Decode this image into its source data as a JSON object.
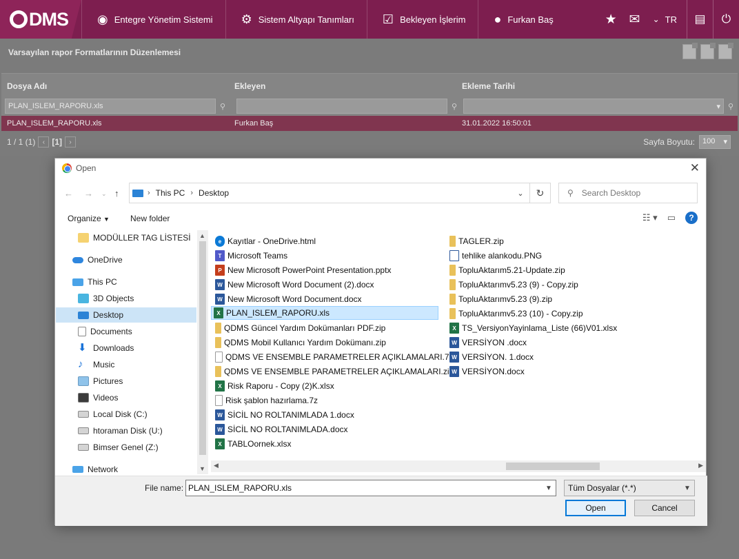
{
  "app": {
    "logo_text": "DMS",
    "nav": [
      {
        "label": "Entegre Yönetim Sistemi",
        "icon": "q-logo-icon"
      },
      {
        "label": "Sistem Altyapı Tanımları",
        "icon": "gear-icon"
      },
      {
        "label": "Bekleyen İşlerim",
        "icon": "task-list-icon"
      },
      {
        "label": "Furkan Baş",
        "icon": "user-icon"
      }
    ],
    "language": "TR",
    "colors": {
      "brand": "#7d1e4f",
      "selected_row": "#80354f",
      "dialog_accent": "#0078d7"
    }
  },
  "page": {
    "title": "Varsayılan rapor Formatlarının Düzenlemesi",
    "columns": [
      "Dosya Adı",
      "Ekleyen",
      "Ekleme Tarihi"
    ],
    "filters": {
      "dosya_adi": "PLAN_ISLEM_RAPORU.xls",
      "ekleyen": "",
      "ekleme_tarihi": ""
    },
    "rows": [
      {
        "dosya_adi": "PLAN_ISLEM_RAPORU.xls",
        "ekleyen": "Furkan Baş",
        "ekleme_tarihi": "31.01.2022 16:50:01"
      }
    ],
    "pager": {
      "info": "1 / 1 (1)",
      "current": "[1]",
      "size_label": "Sayfa Boyutu:",
      "size_value": "100"
    }
  },
  "dialog": {
    "title": "Open",
    "path": [
      "This PC",
      "Desktop"
    ],
    "search_placeholder": "Search Desktop",
    "toolbar": {
      "organize": "Organize",
      "new_folder": "New folder"
    },
    "tree": [
      {
        "label": "MODÜLLER TAG LİSTESİ",
        "icon": "folder-icon",
        "indent": 2
      },
      {
        "label": "OneDrive",
        "icon": "cloud-icon",
        "indent": 1
      },
      {
        "label": "This PC",
        "icon": "computer-icon",
        "indent": 1
      },
      {
        "label": "3D Objects",
        "icon": "cube-icon",
        "indent": 2
      },
      {
        "label": "Desktop",
        "icon": "desktop-icon",
        "indent": 2,
        "selected": true
      },
      {
        "label": "Documents",
        "icon": "document-icon",
        "indent": 2
      },
      {
        "label": "Downloads",
        "icon": "download-icon",
        "indent": 2
      },
      {
        "label": "Music",
        "icon": "music-icon",
        "indent": 2
      },
      {
        "label": "Pictures",
        "icon": "picture-icon",
        "indent": 2
      },
      {
        "label": "Videos",
        "icon": "video-icon",
        "indent": 2
      },
      {
        "label": "Local Disk (C:)",
        "icon": "drive-icon",
        "indent": 2
      },
      {
        "label": "htoraman Disk (U:)",
        "icon": "network-drive-icon",
        "indent": 2
      },
      {
        "label": "Bimser Genel (Z:)",
        "icon": "network-drive-icon",
        "indent": 2
      },
      {
        "label": "Network",
        "icon": "network-icon",
        "indent": 1
      }
    ],
    "files_col1": [
      {
        "name": "Kayıtlar - OneDrive.html",
        "type": "edge"
      },
      {
        "name": "Microsoft Teams",
        "type": "teams"
      },
      {
        "name": "New Microsoft PowerPoint Presentation.pptx",
        "type": "ppt"
      },
      {
        "name": "New Microsoft Word Document (2).docx",
        "type": "word"
      },
      {
        "name": "New Microsoft Word Document.docx",
        "type": "word"
      },
      {
        "name": "PLAN_ISLEM_RAPORU.xls",
        "type": "excel",
        "selected": true
      },
      {
        "name": "QDMS Güncel Yardım Dokümanları PDF.zip",
        "type": "zip"
      },
      {
        "name": "QDMS Mobil Kullanıcı Yardım Dokümanı.zip",
        "type": "zip"
      },
      {
        "name": "QDMS VE ENSEMBLE PARAMETRELER AÇIKLAMALARI.7z",
        "type": "blank"
      },
      {
        "name": "QDMS VE ENSEMBLE PARAMETRELER AÇIKLAMALARI.zip",
        "type": "zip"
      },
      {
        "name": "Risk Raporu - Copy (2)K.xlsx",
        "type": "excel"
      },
      {
        "name": "Risk şablon hazırlama.7z",
        "type": "blank"
      },
      {
        "name": "SİCİL NO ROLTANIMLADA 1.docx",
        "type": "word"
      },
      {
        "name": "SİCİL NO ROLTANIMLADA.docx",
        "type": "word"
      },
      {
        "name": "TABLOornek.xlsx",
        "type": "excel"
      }
    ],
    "files_col2": [
      {
        "name": "TAGLER.zip",
        "type": "zip"
      },
      {
        "name": "tehlike alankodu.PNG",
        "type": "image"
      },
      {
        "name": "TopluAktarım5.21-Update.zip",
        "type": "zip"
      },
      {
        "name": "TopluAktarımv5.23 (9) - Copy.zip",
        "type": "zip"
      },
      {
        "name": "TopluAktarımv5.23 (9).zip",
        "type": "zip"
      },
      {
        "name": "TopluAktarımv5.23 (10) - Copy.zip",
        "type": "zip"
      },
      {
        "name": "TS_VersiyonYayinlama_Liste (66)V01.xlsx",
        "type": "excel"
      },
      {
        "name": "VERSİYON .docx",
        "type": "word"
      },
      {
        "name": "VERSİYON. 1.docx",
        "type": "word"
      },
      {
        "name": "VERSİYON.docx",
        "type": "word"
      }
    ],
    "file_name_label": "File name:",
    "file_name_value": "PLAN_ISLEM_RAPORU.xls",
    "file_type_value": "Tüm Dosyalar (*.*)",
    "open_label": "Open",
    "cancel_label": "Cancel"
  }
}
